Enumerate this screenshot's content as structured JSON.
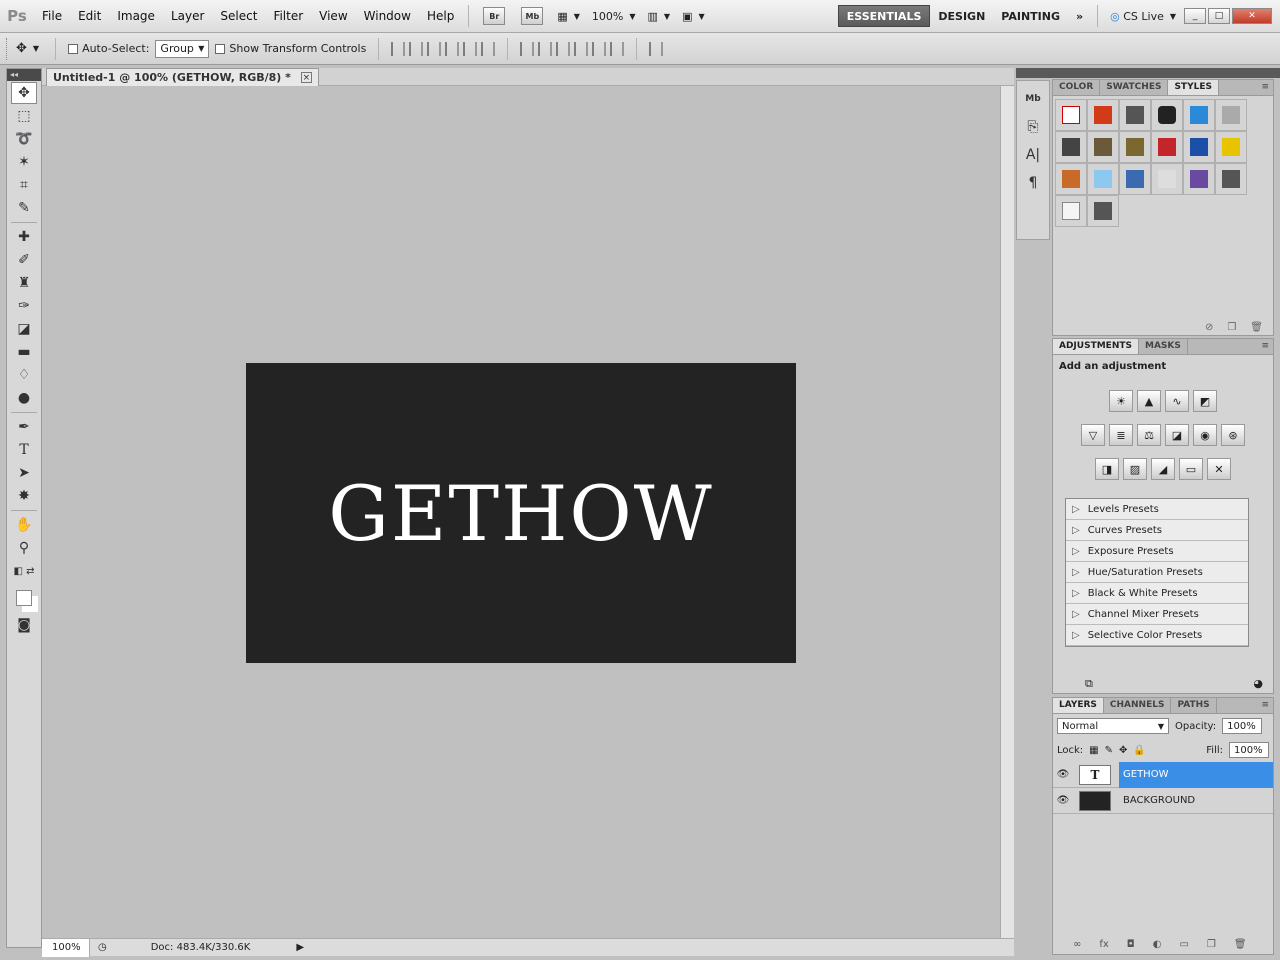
{
  "menubar": {
    "logo": "Ps",
    "menus": [
      "File",
      "Edit",
      "Image",
      "Layer",
      "Select",
      "Filter",
      "View",
      "Window",
      "Help"
    ],
    "bridge": "Br",
    "minibridge": "Mb",
    "zoom": "100%",
    "workspaces": [
      "ESSENTIALS",
      "DESIGN",
      "PAINTING"
    ],
    "more": "»",
    "cslive": "CS Live"
  },
  "options": {
    "autoselect_label": "Auto-Select:",
    "autoselect_value": "Group",
    "transform_label": "Show Transform Controls"
  },
  "document": {
    "tab_title": "Untitled-1 @ 100% (GETHOW, RGB/8) *",
    "close": "×",
    "canvas_text": "GETHOW",
    "canvas_bg": "#232323"
  },
  "status": {
    "zoom": "100%",
    "doc_info": "Doc: 483.4K/330.6K"
  },
  "panels": {
    "styles_tabs": [
      "COLOR",
      "SWATCHES",
      "STYLES"
    ],
    "adjust_tabs": [
      "ADJUSTMENTS",
      "MASKS"
    ],
    "adjust_title": "Add an adjustment",
    "presets": [
      "Levels Presets",
      "Curves Presets",
      "Exposure Presets",
      "Hue/Saturation Presets",
      "Black & White Presets",
      "Channel Mixer Presets",
      "Selective Color Presets"
    ],
    "layer_tabs": [
      "LAYERS",
      "CHANNELS",
      "PATHS"
    ],
    "blend_mode": "Normal",
    "opacity_label": "Opacity:",
    "opacity": "100%",
    "lock_label": "Lock:",
    "fill_label": "Fill:",
    "fill": "100%",
    "layers": [
      {
        "name": "GETHOW",
        "thumb": "T",
        "selected": true
      },
      {
        "name": "BACKGROUND",
        "thumb": "",
        "selected": false
      }
    ]
  },
  "accent": "#3a8ee6"
}
